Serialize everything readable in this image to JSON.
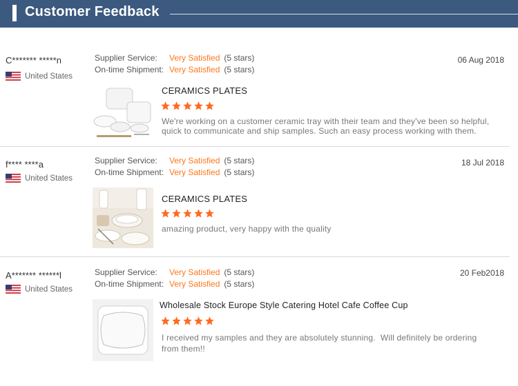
{
  "header": {
    "title": "Customer Feedback"
  },
  "colors": {
    "header_bg": "#3c5a7f",
    "accent": "#ff7519",
    "star": "#ff6a1f"
  },
  "labels": {
    "supplier_service": "Supplier Service:",
    "ontime_shipment": "On-time Shipment:"
  },
  "reviews": [
    {
      "name": "C******* *****n",
      "country": "United States",
      "flag_icon": "us-flag-icon",
      "supplier_rating": "Very Satisfied",
      "supplier_stars": "(5 stars)",
      "shipment_rating": "Very Satisfied",
      "shipment_stars": "(5 stars)",
      "date": "06 Aug 2018",
      "product": "CERAMICS PLATES",
      "stars": 5,
      "comment_line1": "We're working on a customer ceramic tray with their team and they've been so helpful,",
      "comment_line2": "quick to communicate and ship samples. Such an easy process working with them."
    },
    {
      "name": "f**** ****a",
      "country": "United States",
      "flag_icon": "us-flag-icon",
      "supplier_rating": "Very Satisfied",
      "supplier_stars": "(5 stars)",
      "shipment_rating": "Very Satisfied",
      "shipment_stars": "(5 stars)",
      "date": "18 Jul 2018",
      "product": "CERAMICS PLATES",
      "stars": 5,
      "comment_line1": "amazing product, very happy with the quality",
      "comment_line2": ""
    },
    {
      "name": "A******* ******l",
      "country": "United States",
      "flag_icon": "us-flag-icon",
      "supplier_rating": "Very Satisfied",
      "supplier_stars": "(5 stars)",
      "shipment_rating": "Very Satisfied",
      "shipment_stars": "(5 stars)",
      "date": "20 Feb2018",
      "product": "Wholesale Stock Europe Style Catering Hotel Cafe Coffee Cup",
      "stars": 5,
      "comment_line1": "I received my samples and they are absolutely stunning.  Will definitely be ordering",
      "comment_line2": "from them!!"
    }
  ]
}
